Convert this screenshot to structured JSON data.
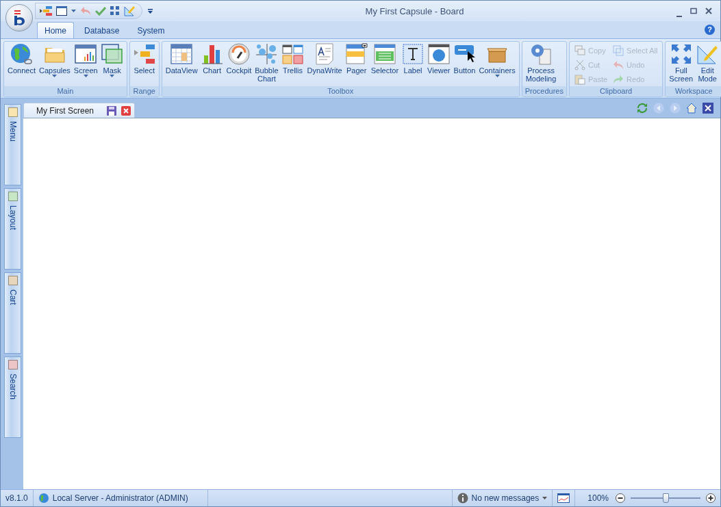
{
  "window": {
    "title": "My First Capsule - Board"
  },
  "ribbon_tabs": [
    {
      "label": "Home",
      "selected": true
    },
    {
      "label": "Database",
      "selected": false
    },
    {
      "label": "System",
      "selected": false
    }
  ],
  "help_button": "?",
  "ribbon_groups": [
    {
      "label": "Main",
      "items": [
        {
          "kind": "large",
          "label": "Connect",
          "dropdown": false
        },
        {
          "kind": "large",
          "label": "Capsules",
          "dropdown": true
        },
        {
          "kind": "large",
          "label": "Screen",
          "dropdown": true
        },
        {
          "kind": "large",
          "label": "Mask",
          "dropdown": true
        }
      ]
    },
    {
      "label": "Range",
      "items": [
        {
          "kind": "large",
          "label": "Select",
          "dropdown": false
        }
      ]
    },
    {
      "label": "Toolbox",
      "items": [
        {
          "kind": "large",
          "label": "DataView",
          "dropdown": false
        },
        {
          "kind": "large",
          "label": "Chart",
          "dropdown": false
        },
        {
          "kind": "large",
          "label": "Cockpit",
          "dropdown": false
        },
        {
          "kind": "large",
          "label": "Bubble\nChart",
          "dropdown": false
        },
        {
          "kind": "large",
          "label": "Trellis",
          "dropdown": false
        },
        {
          "kind": "large",
          "label": "DynaWrite",
          "dropdown": false
        },
        {
          "kind": "large",
          "label": "Pager",
          "dropdown": false
        },
        {
          "kind": "large",
          "label": "Selector",
          "dropdown": false
        },
        {
          "kind": "large",
          "label": "Label",
          "dropdown": false
        },
        {
          "kind": "large",
          "label": "Viewer",
          "dropdown": false
        },
        {
          "kind": "large",
          "label": "Button",
          "dropdown": false
        },
        {
          "kind": "large",
          "label": "Containers",
          "dropdown": true
        }
      ]
    },
    {
      "label": "Procedures",
      "items": [
        {
          "kind": "large",
          "label": "Process\nModeling",
          "dropdown": false
        }
      ]
    },
    {
      "label": "Clipboard",
      "items": [
        {
          "kind": "small",
          "label": "Copy",
          "disabled": true
        },
        {
          "kind": "small",
          "label": "Cut",
          "disabled": true
        },
        {
          "kind": "small",
          "label": "Paste",
          "disabled": true
        },
        {
          "kind": "small",
          "label": "Select All",
          "disabled": true
        },
        {
          "kind": "small",
          "label": "Undo",
          "disabled": true
        },
        {
          "kind": "small",
          "label": "Redo",
          "disabled": true
        }
      ]
    },
    {
      "label": "Workspace",
      "items": [
        {
          "kind": "large",
          "label": "Full\nScreen",
          "dropdown": false
        },
        {
          "kind": "large",
          "label": "Edit\nMode",
          "dropdown": false
        }
      ]
    }
  ],
  "side_tabs": [
    {
      "label": "Menu",
      "color": "#f8e6b0"
    },
    {
      "label": "Layout",
      "color": "#c6e6c4"
    },
    {
      "label": "Cart",
      "color": "#e8d6bc"
    },
    {
      "label": "Search",
      "color": "#ecc6c6"
    }
  ],
  "document_tabs": [
    {
      "label": "My First Screen",
      "selected": true
    }
  ],
  "status_bar": {
    "version": "v8.1.0",
    "server": "Local Server - Administrator (ADMIN)",
    "messages": "No new messages",
    "zoom": "100%",
    "zoom_slider": {
      "level": 0.5
    }
  }
}
